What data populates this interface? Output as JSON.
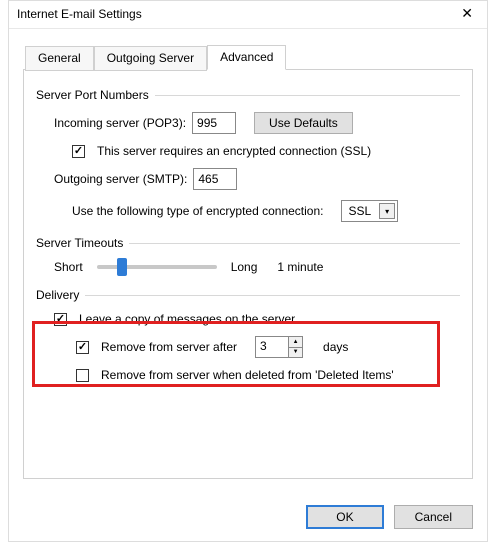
{
  "window": {
    "title": "Internet E-mail Settings"
  },
  "tabs": {
    "general": "General",
    "outgoing": "Outgoing Server",
    "advanced": "Advanced"
  },
  "port_section": {
    "header": "Server Port Numbers",
    "incoming_label": "Incoming server (POP3):",
    "incoming_value": "995",
    "use_defaults": "Use Defaults",
    "ssl_checkbox": "This server requires an encrypted connection (SSL)",
    "outgoing_label": "Outgoing server (SMTP):",
    "outgoing_value": "465",
    "enc_type_label": "Use the following type of encrypted connection:",
    "enc_type_value": "SSL"
  },
  "timeouts": {
    "header": "Server Timeouts",
    "short": "Short",
    "long": "Long",
    "value": "1 minute"
  },
  "delivery": {
    "header": "Delivery",
    "leave_copy": "Leave a copy of messages on the server",
    "remove_after_prefix": "Remove from server after",
    "remove_after_days": "3",
    "days_suffix": "days",
    "remove_deleted": "Remove from server when deleted from 'Deleted Items'"
  },
  "buttons": {
    "ok": "OK",
    "cancel": "Cancel"
  }
}
